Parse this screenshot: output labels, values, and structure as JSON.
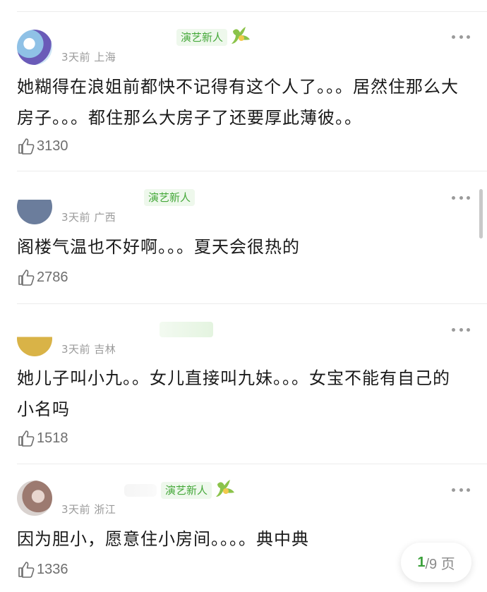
{
  "comments": [
    {
      "meta": "3天前 上海",
      "badge": "演艺新人",
      "text": "她糊得在浪姐前都快不记得有这个人了。。。居然住那么大房子。。。都住那么大房子了还要厚此薄彼。。",
      "likes": "3130",
      "avatar_color": "#9ec9e6"
    },
    {
      "meta": "3天前 广西",
      "badge": "演艺新人",
      "text": "阁楼气温也不好啊。。。夏天会很热的",
      "likes": "2786",
      "avatar_color": "#c8b28a"
    },
    {
      "meta": "3天前 吉林",
      "badge": "",
      "text": "她儿子叫小九。。女儿直接叫九妹。。。女宝不能有自己的小名吗",
      "likes": "1518",
      "avatar_color": "#e0bd4d"
    },
    {
      "meta": "3天前 浙江",
      "badge": "演艺新人",
      "text": "因为胆小，愿意住小房间。。。。典中典",
      "likes": "1336",
      "avatar_color": "#b99a8e"
    }
  ],
  "pager": {
    "current": "1",
    "rest": "/9 页"
  },
  "icons": {
    "more": "more-dots-icon",
    "like": "thumbs-up-icon",
    "badge": "bird-icon"
  },
  "colors": {
    "badge_text": "#45a83a",
    "badge_bg": "#eef8ec",
    "pager_current": "#3aa03a"
  }
}
